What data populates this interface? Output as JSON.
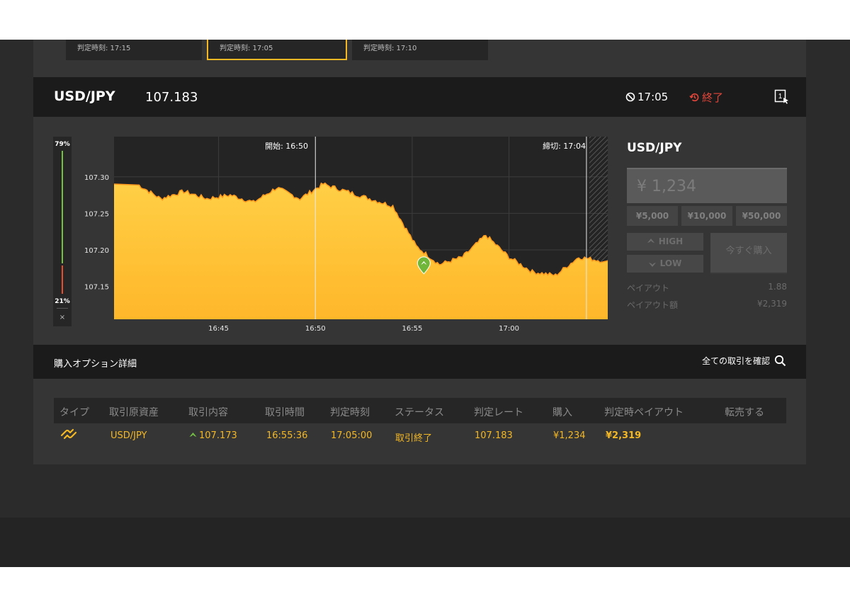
{
  "cards": [
    {
      "label": "判定時刻: 17:15"
    },
    {
      "label": "判定時刻: 17:05"
    },
    {
      "label": "判定時刻: 17:10"
    }
  ],
  "header": {
    "pair": "USD/JPY",
    "price": "107.183",
    "clock_time": "17:05",
    "status_label": "終了",
    "window_badge": "1"
  },
  "gauge": {
    "up_percent": "79%",
    "down_percent": "21%",
    "close_label": "×",
    "up_color": "#74c043",
    "down_color": "#e4502f"
  },
  "chart": {
    "start_label": "開始: 16:50",
    "close_label": "締切: 17:04",
    "y_ticks": [
      "107.30",
      "107.25",
      "107.20",
      "107.15"
    ],
    "x_ticks": [
      "16:45",
      "16:50",
      "16:55",
      "17:00"
    ]
  },
  "chart_data": {
    "type": "area",
    "x_ticks": [
      "16:45",
      "16:50",
      "16:55",
      "17:00"
    ],
    "y_ticks": [
      "107.30",
      "107.25",
      "107.20",
      "107.15"
    ],
    "ylim": [
      107.105,
      107.355
    ],
    "x_minutes_range": [
      16.66,
      17.085
    ],
    "x": [
      16.68,
      16.7,
      16.72,
      16.74,
      16.76,
      16.78,
      16.8,
      16.82,
      16.84,
      16.86,
      16.88,
      16.9,
      16.92,
      16.94,
      16.96,
      16.98,
      17.0,
      17.02,
      17.04,
      17.06,
      17.08
    ],
    "values": [
      107.29,
      107.27,
      107.28,
      107.27,
      107.275,
      107.265,
      107.285,
      107.27,
      107.29,
      107.28,
      107.27,
      107.26,
      107.205,
      107.18,
      107.19,
      107.22,
      107.19,
      107.17,
      107.165,
      107.19,
      107.185
    ],
    "purchase_point": {
      "time": "16:55:36",
      "rate": 107.173
    },
    "start_marker": "16:50",
    "close_marker": "17:04",
    "fill_color": "#ffc83a",
    "line_color": "#ff9a1f"
  },
  "side": {
    "title": "USD/JPY",
    "amount": "¥ 1,234",
    "quick": [
      "¥5,000",
      "¥10,000",
      "¥50,000"
    ],
    "high": "HIGH",
    "low": "LOW",
    "buy": "今すぐ購入",
    "payout_label": "ペイアウト",
    "payout_value": "1.88",
    "payout_amount_label": "ペイアウト額",
    "payout_amount_value": "¥2,319"
  },
  "detail": {
    "title": "購入オプション詳細",
    "confirm": "全ての取引を確認"
  },
  "table": {
    "headers": [
      "タイプ",
      "取引原資産",
      "取引内容",
      "取引時間",
      "判定時刻",
      "ステータス",
      "判定レート",
      "購入",
      "判定時ペイアウト",
      "転売する"
    ],
    "row": {
      "asset": "USD/JPY",
      "content": "107.173",
      "time": "16:55:36",
      "judge_time": "17:05:00",
      "status": "取引終了",
      "rate": "107.183",
      "purchase": "¥1,234",
      "payout": "¥2,319"
    }
  }
}
